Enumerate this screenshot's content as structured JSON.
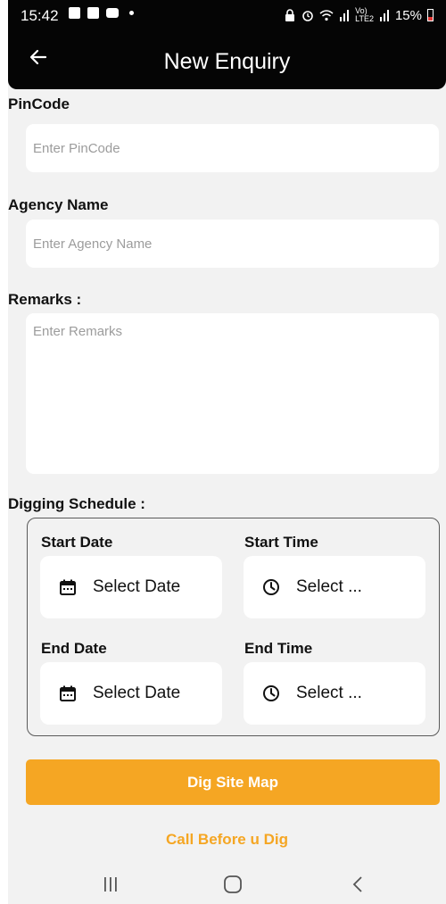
{
  "status_bar": {
    "time": "15:42",
    "network": "Vo)",
    "network2": "LTE2",
    "battery": "15%"
  },
  "header": {
    "title": "New Enquiry",
    "back_icon": "arrow-left-icon"
  },
  "form": {
    "pincode": {
      "label": "PinCode",
      "placeholder": "Enter PinCode",
      "value": ""
    },
    "agency_name": {
      "label": "Agency Name",
      "placeholder": "Enter Agency Name",
      "value": ""
    },
    "remarks": {
      "label": "Remarks :",
      "placeholder": "Enter Remarks",
      "value": ""
    }
  },
  "schedule": {
    "title": "Digging Schedule :",
    "start_date": {
      "label": "Start Date",
      "value": "Select Date",
      "icon": "calendar-icon"
    },
    "start_time": {
      "label": "Start Time",
      "value": "Select ...",
      "icon": "clock-icon"
    },
    "end_date": {
      "label": "End Date",
      "value": "Select Date",
      "icon": "calendar-icon"
    },
    "end_time": {
      "label": "End Time",
      "value": "Select ...",
      "icon": "clock-icon"
    }
  },
  "actions": {
    "primary_label": "Dig Site Map",
    "secondary_label": "Call Before u Dig"
  },
  "colors": {
    "accent": "#f5a623",
    "header_bg": "#050505",
    "page_bg": "#f2f2f2"
  }
}
